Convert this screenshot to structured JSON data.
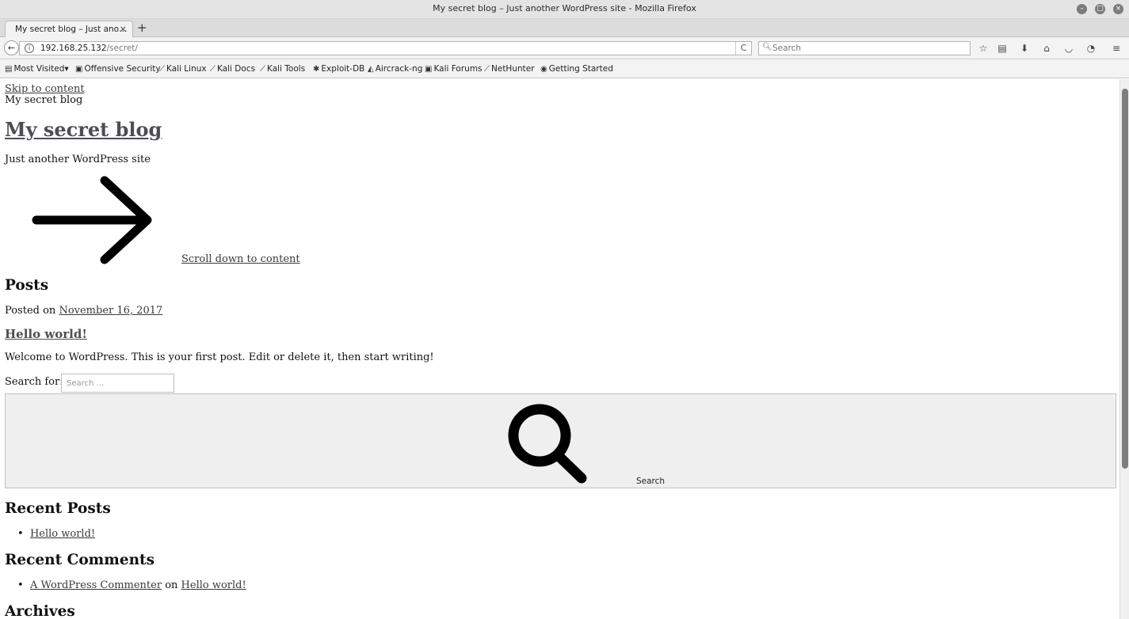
{
  "window": {
    "title": "My secret blog – Just another WordPress site - Mozilla Firefox"
  },
  "tabs": [
    {
      "label": "My secret blog – Just ano…",
      "close": "×"
    }
  ],
  "newtab": "+",
  "navbar": {
    "back": "←",
    "url_host": "192.168.25.132",
    "url_path": "/secret/",
    "reload": "C",
    "search_placeholder": "Search"
  },
  "bookmarks": [
    {
      "label": "Most Visited",
      "icon": "folder-icon",
      "glyph": "▤",
      "suffix": "▾"
    },
    {
      "label": "Offensive Security",
      "icon": "offsec-icon",
      "glyph": "▣"
    },
    {
      "label": "Kali Linux",
      "icon": "kali-icon",
      "glyph": "⟋"
    },
    {
      "label": "Kali Docs",
      "icon": "kali-icon",
      "glyph": "⟋"
    },
    {
      "label": "Kali Tools",
      "icon": "kali-icon",
      "glyph": "⟋"
    },
    {
      "label": "Exploit-DB",
      "icon": "exploitdb-icon",
      "glyph": "✱"
    },
    {
      "label": "Aircrack-ng",
      "icon": "aircrack-icon",
      "glyph": "◭"
    },
    {
      "label": "Kali Forums",
      "icon": "kali-forums-icon",
      "glyph": "▣"
    },
    {
      "label": "NetHunter",
      "icon": "kali-icon",
      "glyph": "⟋"
    },
    {
      "label": "Getting Started",
      "icon": "firefox-icon",
      "glyph": "◉"
    }
  ],
  "page": {
    "skip_link": "Skip to content",
    "site_name_small": "My secret blog",
    "site_title": "My secret blog",
    "tagline": "Just another WordPress site",
    "scroll_link": "Scroll down to content",
    "posts_heading": "Posts",
    "posted_on": "Posted on",
    "post_date": "November 16, 2017",
    "post_title": "Hello world!",
    "post_excerpt": "Welcome to WordPress. This is your first post. Edit or delete it, then start writing!",
    "search_label": "Search for:",
    "search_placeholder": "Search …",
    "search_button": "Search",
    "recent_posts_heading": "Recent Posts",
    "recent_posts": [
      "Hello world!"
    ],
    "recent_comments_heading": "Recent Comments",
    "recent_comment": {
      "author": "A WordPress Commenter",
      "on": "on",
      "post": "Hello world!"
    },
    "archives_heading": "Archives"
  }
}
